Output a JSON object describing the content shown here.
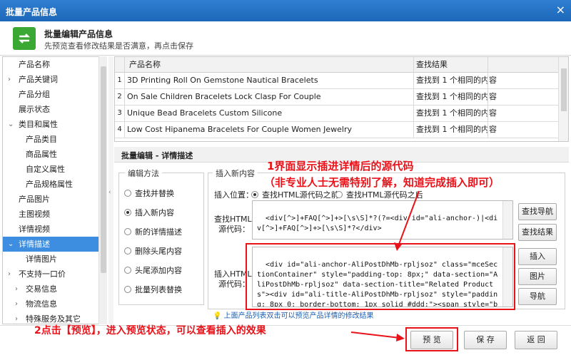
{
  "window": {
    "title": "批量产品信息",
    "close_glyph": "×"
  },
  "header": {
    "title": "批量编辑产品信息",
    "subtitle": "先预览查看修改结果是否满意，再点击保存"
  },
  "sidebar": {
    "items": [
      {
        "label": "产品名称",
        "level": 1,
        "arrow": ""
      },
      {
        "label": "产品关键词",
        "level": 1,
        "arrow": "›"
      },
      {
        "label": "产品分组",
        "level": 1,
        "arrow": ""
      },
      {
        "label": "展示状态",
        "level": 1,
        "arrow": ""
      },
      {
        "label": "类目和属性",
        "level": 1,
        "arrow": "⌄"
      },
      {
        "label": "产品类目",
        "level": 2,
        "arrow": ""
      },
      {
        "label": "商品属性",
        "level": 2,
        "arrow": ""
      },
      {
        "label": "自定义属性",
        "level": 2,
        "arrow": ""
      },
      {
        "label": "产品规格属性",
        "level": 2,
        "arrow": ""
      },
      {
        "label": "产品图片",
        "level": 1,
        "arrow": ""
      },
      {
        "label": "主图视频",
        "level": 1,
        "arrow": ""
      },
      {
        "label": "详情视频",
        "level": 1,
        "arrow": ""
      },
      {
        "label": "详情描述",
        "level": 1,
        "arrow": "⌄",
        "selected": true
      },
      {
        "label": "详情图片",
        "level": 2,
        "arrow": ""
      },
      {
        "label": "不支持一口价",
        "level": 1,
        "arrow": "›"
      },
      {
        "label": "交易信息",
        "level": 2,
        "arrow": "›"
      },
      {
        "label": "物流信息",
        "level": 2,
        "arrow": "›"
      },
      {
        "label": "特殊服务及其它",
        "level": 2,
        "arrow": "›"
      }
    ]
  },
  "grid": {
    "columns": [
      "产品名称",
      "查找结果"
    ],
    "rows": [
      {
        "n": "1",
        "name": "3D Printing Roll On Gemstone Nautical Bracelets",
        "result": "查找到 1 个相同的内容"
      },
      {
        "n": "2",
        "name": "On Sale Children Bracelets Lock Clasp For Couple",
        "result": "查找到 1 个相同的内容"
      },
      {
        "n": "3",
        "name": "Unique Bead Bracelets Custom Silicone",
        "result": "查找到 1 个相同的内容"
      },
      {
        "n": "4",
        "name": "Low Cost Hipanema Bracelets For Couple Women Jewelry",
        "result": "查找到 1 个相同的内容"
      }
    ]
  },
  "detail": {
    "section_title": "批量编辑 - 详情描述",
    "method_legend": "编辑方法",
    "methods": [
      {
        "label": "查找并替换",
        "checked": false
      },
      {
        "label": "插入新内容",
        "checked": true
      },
      {
        "label": "新的详情描述",
        "checked": false
      },
      {
        "label": "删除头尾内容",
        "checked": false
      },
      {
        "label": "头尾添加内容",
        "checked": false
      },
      {
        "label": "批量列表替换",
        "checked": false
      }
    ],
    "insert_legend": "插入新内容",
    "position_label": "插入位置：",
    "position_options": [
      {
        "label": "查找HTML源代码之前",
        "checked": true
      },
      {
        "label": "查找HTML源代码之后",
        "checked": false
      }
    ],
    "find_label_1": "查找HTML",
    "find_label_2": "源代码：",
    "find_value": "<div[^>]+FAQ[^>]+>[\\s\\S]*?(?=<div id=\"ali-anchor-)|<div[^>]+FAQ[^>]+>[\\s\\S]*?</div>",
    "insert_label_1": "插入HTML",
    "insert_label_2": "源代码：",
    "insert_value": "<div id=\"ali-anchor-AliPostDhMb-rpljsoz\" class=\"mceSectionContainer\" style=\"padding-top: 8px;\" data-section=\"AliPostDhMb-rpljsoz\" data-section-title=\"Related Products\"><div id=\"ali-title-AliPostDhMb-rpljsoz\" style=\"padding: 8px 0; border-bottom: 1px solid #ddd;\"><span style=\"background-color: #ddd; color: #333; font-weight: bold; padding: 8px 10px; line-height: 12px;\">Related Products</span></div><div",
    "buttons": {
      "find_nav": "查找导航",
      "find_result": "查找结果",
      "insert": "插入",
      "image": "图片",
      "nav": "导航"
    },
    "hint": "上面产品列表双击可以预览产品详情的修改结果"
  },
  "footer": {
    "preview": "预 览",
    "save": "保 存",
    "back": "返 回"
  },
  "annotations": {
    "note1": "1界面显示插进详情后的源代码",
    "note2": "（非专业人士无需特别了解，知道完成插入即可）",
    "note3": "2点击【预览】，进入预览状态，可以查看插入的效果",
    "color": "#e8131a"
  }
}
